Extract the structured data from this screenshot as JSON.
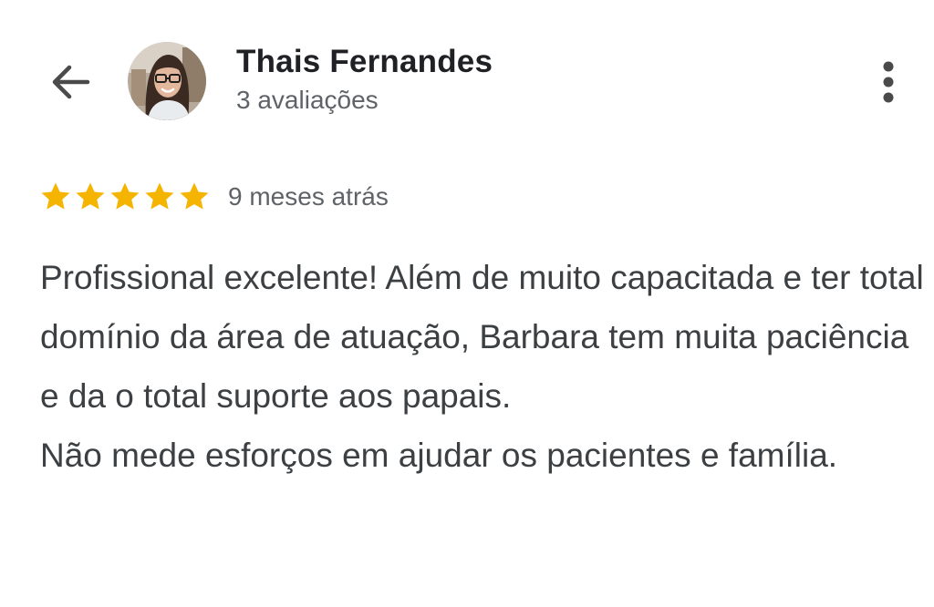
{
  "header": {
    "back_icon": "arrow-left-icon",
    "more_icon": "more-vertical-icon",
    "reviewer_name": "Thais Fernandes",
    "review_count": "3 avaliações"
  },
  "review": {
    "rating": 5,
    "rating_max": 5,
    "star_color": "#F4B400",
    "date": "9 meses atrás",
    "paragraphs": [
      "Profissional excelente! Além de muito capacitada e ter total domínio da área de atuação, Barbara tem muita paciência e da o total suporte aos papais.",
      "Não mede esforços em ajudar os pacientes e família."
    ]
  },
  "colors": {
    "name_text": "#202124",
    "secondary_text": "#5f6368",
    "body_text": "#3c4043",
    "icon": "#4a4a4a"
  }
}
